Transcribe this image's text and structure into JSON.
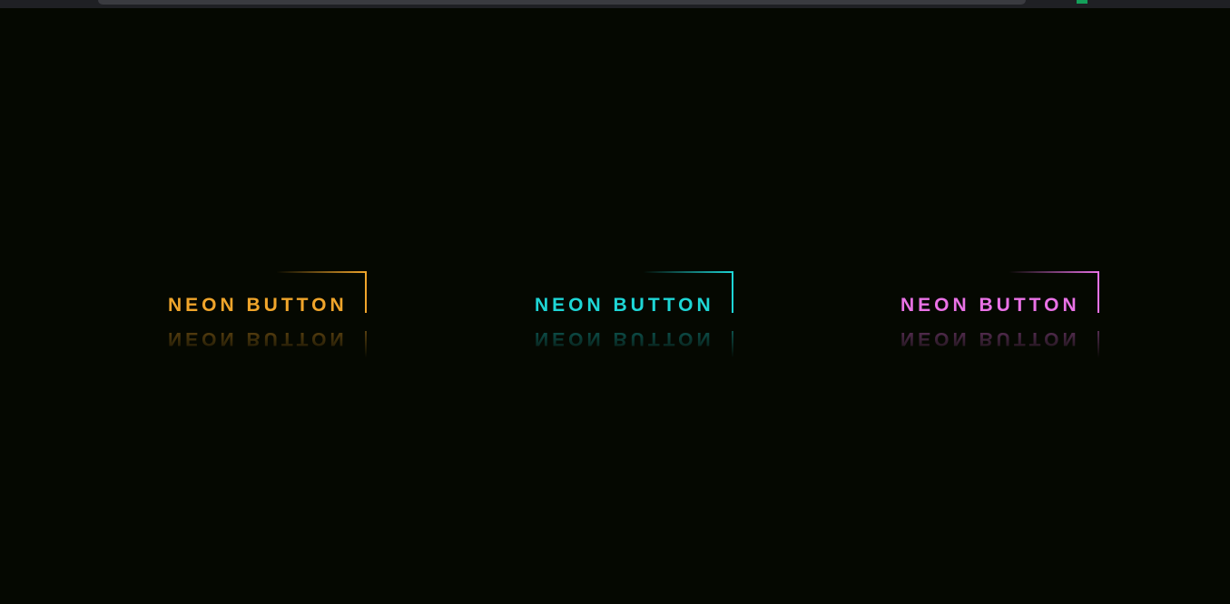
{
  "buttons": [
    {
      "label": "NEON BUTTON",
      "color": "#f0a52b"
    },
    {
      "label": "NEON BUTTON",
      "color": "#1ed6d6"
    },
    {
      "label": "NEON BUTTON",
      "color": "#ea72e6"
    }
  ],
  "colors": {
    "background": "#050801",
    "topbar": "#1f2024"
  }
}
